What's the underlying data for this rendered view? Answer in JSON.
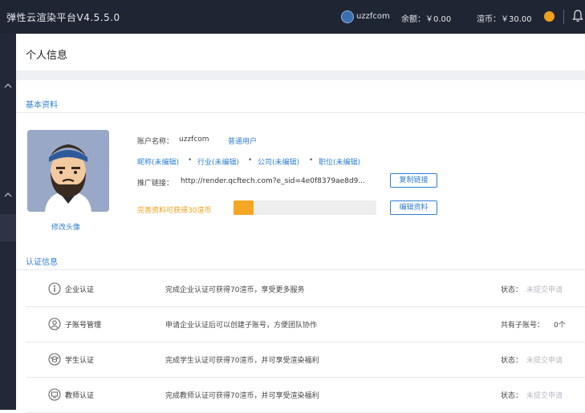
{
  "header": {
    "app_title": "弹性云渲染平台V4.5.5.0",
    "user_name": "uzzfcom",
    "balance": "余额：￥0.00",
    "coins": "渲币：￥30.00"
  },
  "page": {
    "title": "个人信息"
  },
  "basic_info": {
    "section_title": "基本资料",
    "change_avatar_label": "修改头像",
    "account_label": "账户名称：",
    "account_value": "uzzfcom",
    "account_type": "普通用户",
    "nickname": "昵称(未编辑)",
    "industry": "行业(未编辑)",
    "company": "公司(未编辑)",
    "position": "职位(未编辑)",
    "promo_label": "推广链接：",
    "promo_url": "http://render.qcftech.com?e_sid=4e0f8379ae8d9...",
    "copy_button": "复制链接",
    "complete_hint": "完善资料可获得30渲币",
    "edit_button": "编辑资料",
    "profile_progress": 0.14,
    "bullet": "•"
  },
  "certification": {
    "section_title": "认证信息",
    "rows": [
      {
        "name": "企业认证",
        "desc": "完成企业认证可获得70渲币，享受更多服务",
        "status_label": "状态：",
        "status_value": "未提交申请",
        "icon": "info-icon"
      },
      {
        "name": "子账号管理",
        "desc": "申请企业认证后可以创建子账号，方便团队协作",
        "status_label": "共有子账号：",
        "status_value": "0个",
        "icon": "user-icon"
      },
      {
        "name": "学生认证",
        "desc": "完成学生认证可获得70渲币，并可享受渲染福利",
        "status_label": "状态：",
        "status_value": "未提交申请",
        "icon": "student-icon"
      },
      {
        "name": "教师认证",
        "desc": "完成教师认证可获得70渲币，并可享受渲染福利",
        "status_label": "状态：",
        "status_value": "未提交申请",
        "icon": "teacher-icon"
      }
    ]
  },
  "colors": {
    "topbar": "#1f2533",
    "accent": "#2f7fd2",
    "orange": "#f5a623"
  }
}
